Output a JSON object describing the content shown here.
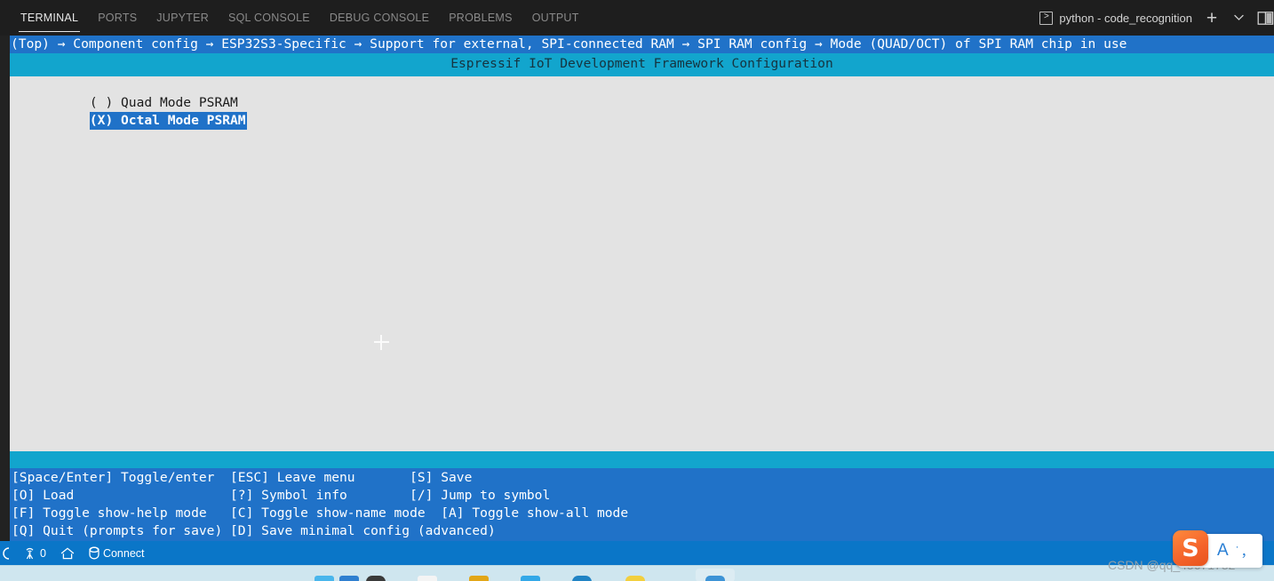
{
  "panel": {
    "tabs": [
      {
        "label": "TERMINAL",
        "active": true
      },
      {
        "label": "PORTS",
        "active": false
      },
      {
        "label": "JUPYTER",
        "active": false
      },
      {
        "label": "SQL CONSOLE",
        "active": false
      },
      {
        "label": "DEBUG CONSOLE",
        "active": false
      },
      {
        "label": "PROBLEMS",
        "active": false
      },
      {
        "label": "OUTPUT",
        "active": false
      }
    ],
    "active_terminal": {
      "name": "python - code_recognition",
      "icon": "terminal-icon",
      "glyph": ">"
    },
    "actions": {
      "new_terminal": "+",
      "new_terminal_icon": "plus-icon",
      "dropdown": "⌄",
      "dropdown_icon": "chevron-down-icon",
      "split_icon": "split-panel-icon"
    }
  },
  "menuconfig": {
    "breadcrumb": "(Top) → Component config → ESP32S3-Specific → Support for external, SPI-connected RAM → SPI RAM config → Mode (QUAD/OCT) of SPI RAM chip in use",
    "title": "Espressif IoT Development Framework Configuration",
    "options": [
      {
        "marker": "( )",
        "label": "Quad Mode PSRAM",
        "selected": false,
        "text": "( ) Quad Mode PSRAM"
      },
      {
        "marker": "(X)",
        "label": "Octal Mode PSRAM",
        "selected": true,
        "text": "(X) Octal Mode PSRAM"
      }
    ],
    "footer_rows": [
      "[Space/Enter] Toggle/enter  [ESC] Leave menu       [S] Save",
      "[O] Load                    [?] Symbol info        [/] Jump to symbol",
      "[F] Toggle show-help mode   [C] Toggle show-name mode  [A] Toggle show-all mode",
      "[Q] Quit (prompts for save) [D] Save minimal config (advanced)"
    ],
    "keybindings": [
      {
        "key": "[Space/Enter]",
        "action": "Toggle/enter"
      },
      {
        "key": "[ESC]",
        "action": "Leave menu"
      },
      {
        "key": "[S]",
        "action": "Save"
      },
      {
        "key": "[O]",
        "action": "Load"
      },
      {
        "key": "[?]",
        "action": "Symbol info"
      },
      {
        "key": "[/]",
        "action": "Jump to symbol"
      },
      {
        "key": "[F]",
        "action": "Toggle show-help mode"
      },
      {
        "key": "[C]",
        "action": "Toggle show-name mode"
      },
      {
        "key": "[A]",
        "action": "Toggle show-all mode"
      },
      {
        "key": "[Q]",
        "action": "Quit (prompts for save)"
      },
      {
        "key": "[D]",
        "action": "Save minimal config (advanced)"
      }
    ],
    "colors": {
      "breadcrumb_bg": "#2072c8",
      "title_bg": "#12a5cd",
      "body_bg": "#e3e3e3",
      "footer_bg": "#2072c8",
      "selection_bg": "#2072c8"
    }
  },
  "statusbar": {
    "items": [
      {
        "label": "",
        "icon": "remote-indicator-icon"
      },
      {
        "label": "0",
        "icon": "radio-tower-icon"
      },
      {
        "label": "",
        "icon": "home-icon"
      },
      {
        "label": "Connect",
        "icon": "database-icon"
      }
    ],
    "background": "#0a76c8"
  },
  "ime": {
    "logo": "S",
    "logo_icon": "sogou-logo-icon",
    "mode": "A",
    "punctuation": "˙，"
  },
  "watermark": "CSDN @qq_45671732"
}
